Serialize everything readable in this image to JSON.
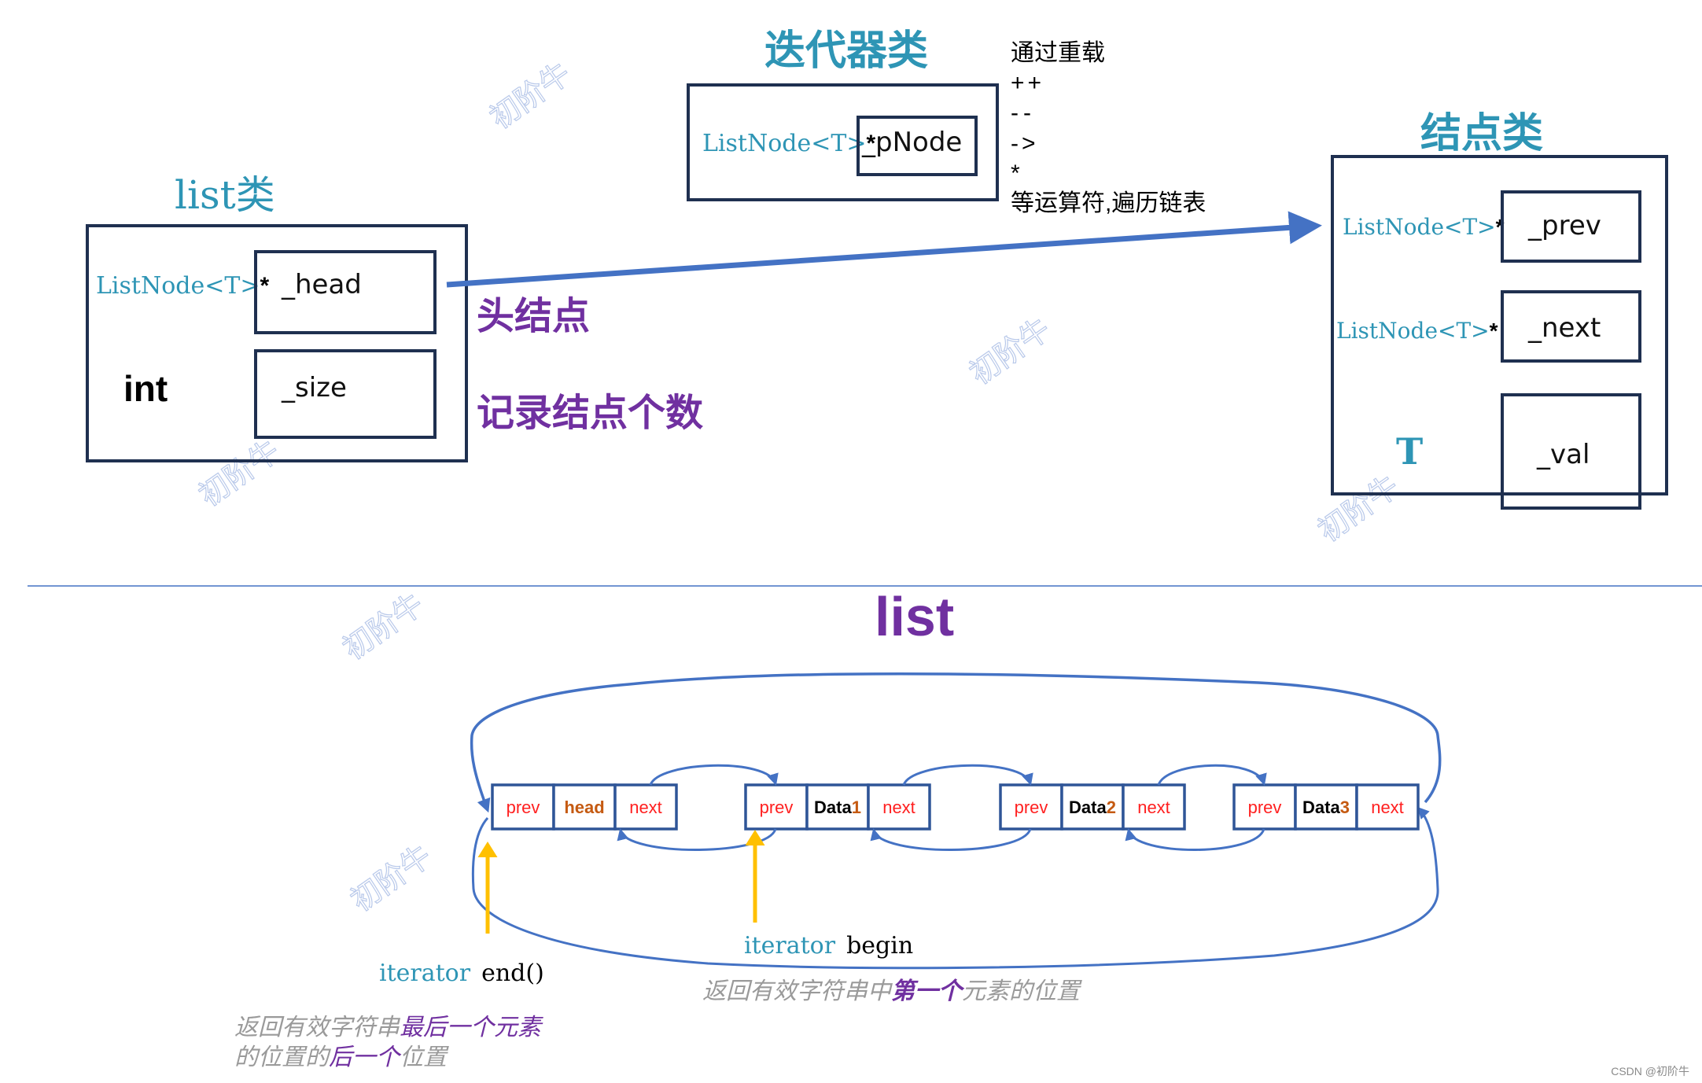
{
  "list_class": {
    "title": "list类",
    "fields": [
      {
        "type": "ListNode<T>",
        "ptr": "*",
        "name": "_head",
        "annotation": "头结点"
      },
      {
        "type": "int",
        "ptr": "",
        "name": "_size",
        "annotation": "记录结点个数"
      }
    ]
  },
  "iterator_class": {
    "title": "迭代器类",
    "field": {
      "type": "ListNode<T>",
      "ptr": "*",
      "name": "_pNode"
    },
    "notes": [
      "通过重载",
      "++",
      "--",
      "->",
      "*",
      "等运算符,遍历链表"
    ]
  },
  "node_class": {
    "title": "结点类",
    "fields": [
      {
        "type": "ListNode<T>",
        "ptr": "*",
        "name": "_prev"
      },
      {
        "type": "ListNode<T>",
        "ptr": "*",
        "name": "_next"
      },
      {
        "type": "T",
        "ptr": "",
        "name": "_val"
      }
    ]
  },
  "list_diagram": {
    "title": "list",
    "nodes": [
      {
        "prev": "prev",
        "data": "head",
        "data_suffix": "",
        "next": "next",
        "is_head": true
      },
      {
        "prev": "prev",
        "data": "Data",
        "data_suffix": "1",
        "next": "next",
        "is_head": false
      },
      {
        "prev": "prev",
        "data": "Data",
        "data_suffix": "2",
        "next": "next",
        "is_head": false
      },
      {
        "prev": "prev",
        "data": "Data",
        "data_suffix": "3",
        "next": "next",
        "is_head": false
      }
    ],
    "end_label": {
      "kw": "iterator",
      "name": "end()"
    },
    "begin_label": {
      "kw": "iterator",
      "name": "begin"
    },
    "begin_note": {
      "pre": "返回有效字符串中",
      "hl": "第一个",
      "post": "元素的位置"
    },
    "end_note": {
      "line1_pre": "返回有效字符串",
      "line1_hl": "最后一个元素",
      "line2_pre": "的位置的",
      "line2_hl": "后一个",
      "line2_post": "位置"
    }
  },
  "watermark": "初阶牛",
  "credit": "CSDN @初阶牛",
  "colors": {
    "teal": "#2E95B5",
    "purple": "#7030A0",
    "box": "#1F3050",
    "link": "#4472C4",
    "pointer": "#FFC000",
    "cell_red": "#FF2020",
    "cell_orange": "#C55A11"
  }
}
